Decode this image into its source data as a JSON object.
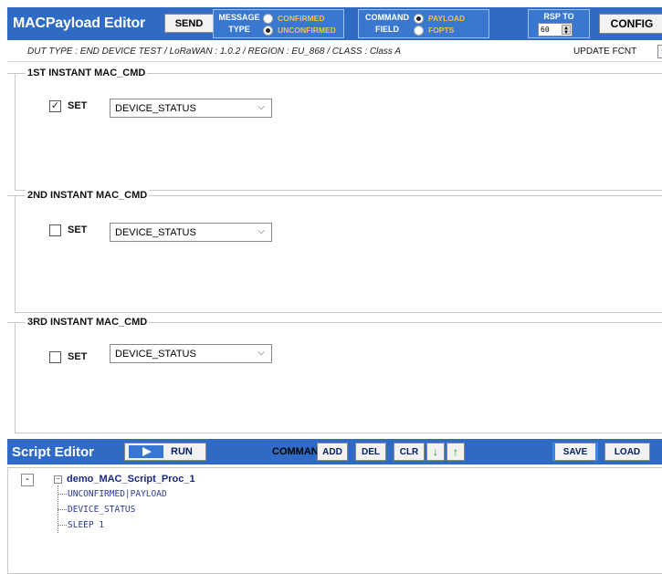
{
  "header": {
    "app_title": "MACPayload Editor",
    "send_label": "SEND",
    "message_type": {
      "label_line1": "MESSAGE",
      "label_line2": "TYPE",
      "options": [
        "CONFIRMED",
        "UNCONFIRMED"
      ],
      "selected": "UNCONFIRMED"
    },
    "command_field": {
      "label_line1": "COMMAND",
      "label_line2": "FIELD",
      "options": [
        "PAYLOAD",
        "FOPTS"
      ],
      "selected": "PAYLOAD"
    },
    "rsp_to": {
      "label": "RSP TO",
      "value": "60"
    },
    "config_label": "CONFIG"
  },
  "info": {
    "dut_line": "DUT TYPE : END DEVICE TEST / LoRaWAN : 1.0.2 / REGION : EU_868 / CLASS : Class A",
    "update_fcnt_label": "UPDATE FCNT",
    "fcnt_button": "+"
  },
  "sections": [
    {
      "title": "1ST INSTANT MAC_CMD",
      "set_label": "SET",
      "checked": true,
      "command": "DEVICE_STATUS"
    },
    {
      "title": "2ND INSTANT MAC_CMD",
      "set_label": "SET",
      "checked": false,
      "command": "DEVICE_STATUS"
    },
    {
      "title": "3RD INSTANT MAC_CMD",
      "set_label": "SET",
      "checked": false,
      "command": "DEVICE_STATUS"
    }
  ],
  "script_editor": {
    "title": "Script Editor",
    "run_label": "RUN",
    "command_label": "COMMAND",
    "add_label": "ADD",
    "del_label": "DEL",
    "clr_label": "CLR",
    "down_label": "↓",
    "up_label": "↑",
    "save_label": "SAVE",
    "load_label": "LOAD"
  },
  "tree": {
    "collapse_label": "-",
    "root": "demo_MAC_Script_Proc_1",
    "items": [
      "UNCONFIRMED|PAYLOAD",
      "DEVICE_STATUS",
      "SLEEP 1"
    ]
  },
  "colors": {
    "header_blue": "#2f6bc4",
    "option_yellow": "#f3c240",
    "tree_text": "#2a3a90"
  }
}
